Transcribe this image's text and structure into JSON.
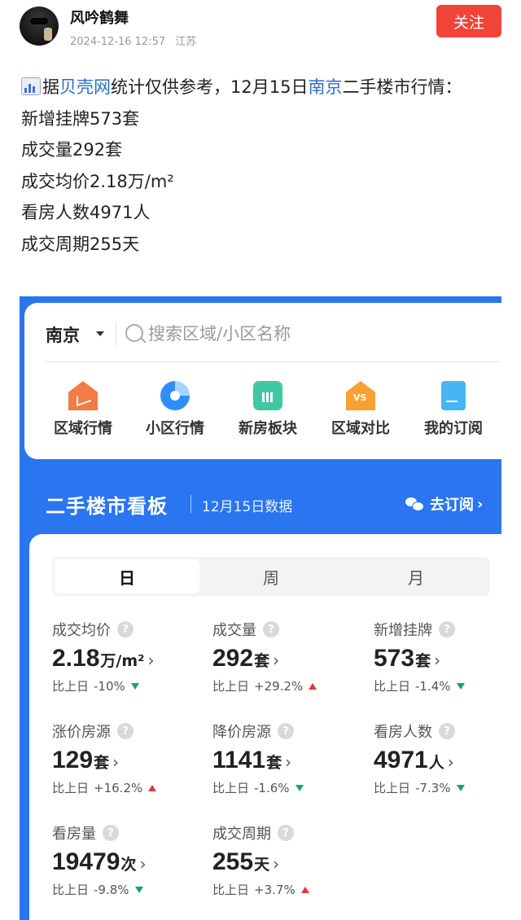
{
  "post": {
    "author": "风吟鹤舞",
    "date": "2024-12-16 12:57",
    "location": "江苏",
    "follow_label": "关注",
    "lead_emoji": "chart-emoji",
    "line1_pre": "据",
    "line1_link1": "贝壳网",
    "line1_mid": "统计仅供参考，12月15日",
    "line1_link2": "南京",
    "line1_post": "二手楼市行情：",
    "lines": [
      "新增挂牌573套",
      "成交量292套",
      "成交均价2.18万/m²",
      "看房人数4971人",
      "成交周期255天"
    ],
    "link_color": "#2a6fc9",
    "follow_color": "#f0443b"
  },
  "app": {
    "city": "南京",
    "search_placeholder": "搜索区域/小区名称",
    "nav": [
      {
        "label": "区域行情",
        "icon": "chart-house-icon"
      },
      {
        "label": "小区行情",
        "icon": "pie-chart-icon"
      },
      {
        "label": "新房板块",
        "icon": "bar-chart-icon"
      },
      {
        "label": "区域对比",
        "icon": "vs-house-icon"
      },
      {
        "label": "我的订阅",
        "icon": "subscription-icon"
      }
    ],
    "board_title": "二手楼市看板",
    "board_date": "12月15日数据",
    "subscribe_label": "去订阅",
    "accent": "#2a75f0",
    "tabs": [
      "日",
      "周",
      "月"
    ],
    "active_tab": "日",
    "compare_prefix": "比上日",
    "up_color": "#e0383e",
    "down_color": "#16a36a",
    "stats": [
      {
        "label": "成交均价",
        "value": "2.18",
        "unit": "万/m²",
        "change": "-10%",
        "dir": "down"
      },
      {
        "label": "成交量",
        "value": "292",
        "unit": "套",
        "change": "+29.2%",
        "dir": "up"
      },
      {
        "label": "新增挂牌",
        "value": "573",
        "unit": "套",
        "change": "-1.4%",
        "dir": "down"
      },
      {
        "label": "涨价房源",
        "value": "129",
        "unit": "套",
        "change": "+16.2%",
        "dir": "up"
      },
      {
        "label": "降价房源",
        "value": "1141",
        "unit": "套",
        "change": "-1.6%",
        "dir": "down"
      },
      {
        "label": "看房人数",
        "value": "4971",
        "unit": "人",
        "change": "-7.3%",
        "dir": "down"
      },
      {
        "label": "看房量",
        "value": "19479",
        "unit": "次",
        "change": "-9.8%",
        "dir": "down"
      },
      {
        "label": "成交周期",
        "value": "255",
        "unit": "天",
        "change": "+3.7%",
        "dir": "up"
      }
    ]
  }
}
